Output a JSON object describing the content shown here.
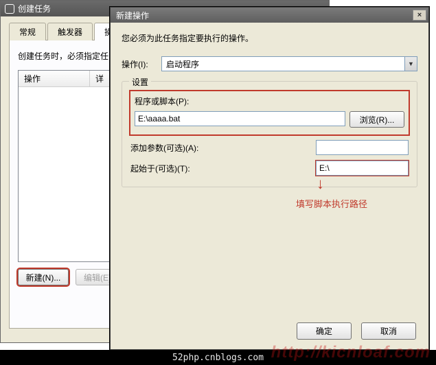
{
  "back": {
    "title": "创建任务",
    "tabs": [
      "常规",
      "触发器",
      "操作"
    ],
    "hint": "创建任务时，必须指定任",
    "list_header": [
      "操作",
      "详"
    ],
    "new_btn": "新建(N)...",
    "edit_btn": "编辑(E)..."
  },
  "front": {
    "title": "新建操作",
    "close": "×",
    "instruction": "您必须为此任务指定要执行的操作。",
    "op_label": "操作(I):",
    "op_value": "启动程序",
    "settings_legend": "设置",
    "program_label": "程序或脚本(P):",
    "program_value": "E:\\aaaa.bat",
    "browse_btn": "浏览(R)...",
    "args_label": "添加参数(可选)(A):",
    "args_value": "",
    "startin_label": "起始于(可选)(T):",
    "startin_value": "E:\\",
    "annotation": "填写脚本执行路径",
    "ok_btn": "确定",
    "cancel_btn": "取消"
  },
  "footer": {
    "credit": "52php.cnblogs.com",
    "watermark": "http://kicnloaf.com"
  }
}
